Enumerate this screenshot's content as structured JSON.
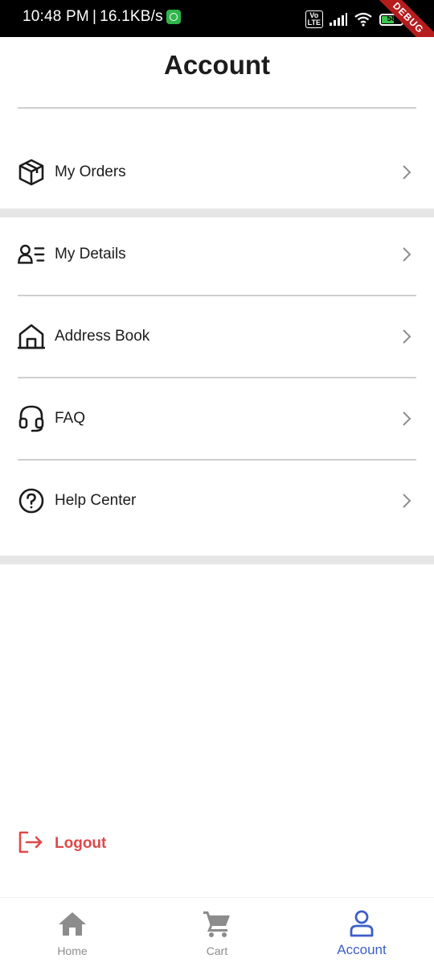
{
  "status_bar": {
    "time": "10:48 PM",
    "separator": "|",
    "network_speed": "16.1KB/s",
    "volte_label": "Vo\nLTE",
    "battery_level": "58",
    "debug_label": "DEBUG"
  },
  "header": {
    "title": "Account"
  },
  "menu": {
    "orders": {
      "label": "My Orders",
      "icon": "package-icon"
    },
    "details": {
      "label": "My Details",
      "icon": "user-details-icon"
    },
    "address": {
      "label": "Address Book",
      "icon": "house-icon"
    },
    "faq": {
      "label": "FAQ",
      "icon": "headset-icon"
    },
    "help": {
      "label": "Help Center",
      "icon": "question-circle-icon"
    }
  },
  "logout": {
    "label": "Logout",
    "color": "#e04848"
  },
  "bottom_nav": {
    "items": [
      {
        "label": "Home",
        "icon": "home-icon",
        "active": false
      },
      {
        "label": "Cart",
        "icon": "cart-icon",
        "active": false
      },
      {
        "label": "Account",
        "icon": "account-icon",
        "active": true
      }
    ],
    "active_color": "#3c5fc7",
    "inactive_color": "#8c8c8c"
  }
}
